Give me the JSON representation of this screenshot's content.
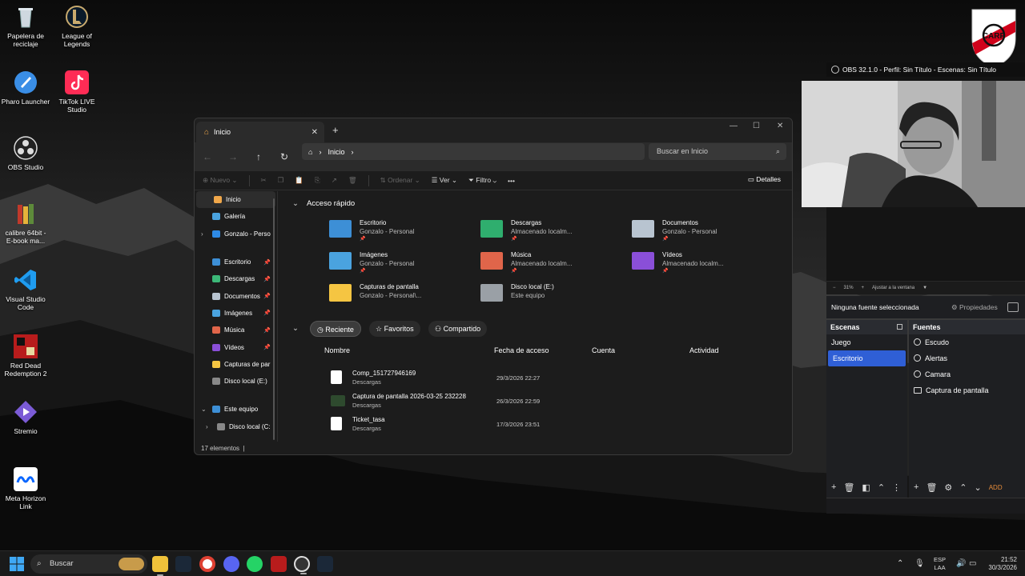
{
  "desktop": {
    "icons": [
      {
        "label_line1": "Papelera de",
        "label_line2": "reciclaje",
        "icon": "recycle-bin-icon"
      },
      {
        "label_line1": "League of",
        "label_line2": "Legends",
        "icon": "league-of-legends-icon"
      },
      {
        "label_line1": "Pharo Launcher",
        "label_line2": "",
        "icon": "pharo-launcher-icon"
      },
      {
        "label_line1": "TikTok LIVE",
        "label_line2": "Studio",
        "icon": "tiktok-live-icon"
      },
      {
        "label_line1": "OBS Studio",
        "label_line2": "",
        "icon": "obs-icon"
      },
      {
        "label_line1": "calibre 64bit -",
        "label_line2": "E-book ma...",
        "icon": "calibre-icon"
      },
      {
        "label_line1": "Visual Studio",
        "label_line2": "Code",
        "icon": "vscode-icon"
      },
      {
        "label_line1": "Red Dead",
        "label_line2": "Redemption 2",
        "icon": "rdr2-icon"
      },
      {
        "label_line1": "Stremio",
        "label_line2": "",
        "icon": "stremio-icon"
      },
      {
        "label_line1": "Meta Horizon",
        "label_line2": "Link",
        "icon": "meta-icon"
      }
    ]
  },
  "explorer": {
    "tab_title": "Inicio",
    "address": "Inicio",
    "search_placeholder": "Buscar en Inicio",
    "commands": {
      "nuevo": "Nuevo",
      "ordenar": "Ordenar",
      "ver": "Ver",
      "filtro": "Filtro",
      "more": "•••",
      "detalles": "Detalles"
    },
    "sidebar": [
      {
        "label": "Inicio",
        "color": "#f0a74a"
      },
      {
        "label": "Galería",
        "color": "#4aa3df"
      },
      {
        "label": "Gonzalo - Perso",
        "color": "#2e8ae6"
      },
      {
        "label": "Escritorio",
        "color": "#3d8fd6"
      },
      {
        "label": "Descargas",
        "color": "#3cb878"
      },
      {
        "label": "Documentos",
        "color": "#b8c4d0"
      },
      {
        "label": "Imágenes",
        "color": "#4aa3df"
      },
      {
        "label": "Música",
        "color": "#e0654a"
      },
      {
        "label": "Vídeos",
        "color": "#8a4fd8"
      },
      {
        "label": "Capturas de par",
        "color": "#f5c542"
      },
      {
        "label": "Disco local (E:)",
        "color": "#888888"
      },
      {
        "label": "Este equipo",
        "color": "#3d8fd6"
      },
      {
        "label": "Disco local (C:",
        "color": "#888888"
      }
    ],
    "quick_access_title": "Acceso rápido",
    "quick_access": [
      {
        "name": "Escritorio",
        "sub": "Gonzalo - Personal",
        "color": "#3d8fd6"
      },
      {
        "name": "Descargas",
        "sub": "Almacenado localm...",
        "color": "#2fae6e"
      },
      {
        "name": "Documentos",
        "sub": "Gonzalo - Personal",
        "color": "#b8c4d0"
      },
      {
        "name": "Imágenes",
        "sub": "Gonzalo - Personal",
        "color": "#4aa3df"
      },
      {
        "name": "Música",
        "sub": "Almacenado localm...",
        "color": "#e0654a"
      },
      {
        "name": "Vídeos",
        "sub": "Almacenado localm...",
        "color": "#8a4fd8"
      },
      {
        "name": "Capturas de pantalla",
        "sub": "Gonzalo - Personal\\...",
        "color": "#f5c542"
      },
      {
        "name": "Disco local (E:)",
        "sub": "Este equipo",
        "color": "#9aa0a6"
      }
    ],
    "pills": [
      "Reciente",
      "Favoritos",
      "Compartido"
    ],
    "columns": [
      "Nombre",
      "Fecha de acceso",
      "Cuenta",
      "Actividad"
    ],
    "files": [
      {
        "name": "Comp_151727946169",
        "location": "Descargas",
        "date": "29/3/2026 22:27",
        "icon": "chrome-pdf-icon"
      },
      {
        "name": "Captura de pantalla 2026-03-25 232228",
        "location": "Descargas",
        "date": "26/3/2026 22:59",
        "icon": "image-file-icon"
      },
      {
        "name": "Ticket_tasa",
        "location": "Descargas",
        "date": "17/3/2026 23:51",
        "icon": "chrome-pdf-icon"
      }
    ],
    "status": "17 elementos"
  },
  "obs": {
    "title": "OBS 32.1.0 - Perfil: Sin Título - Escenas: Sin Título",
    "zoom": "31%",
    "zoom_mode": "Ajustar a la ventana",
    "no_source": "Ninguna fuente seleccionada",
    "properties": "Propiedades",
    "scenes_title": "Escenas",
    "scenes": [
      "Juego",
      "Escritorio"
    ],
    "sources_title": "Fuentes",
    "sources": [
      "Escudo",
      "Alertas",
      "Camara",
      "Captura de pantalla"
    ],
    "add_label": "ADD"
  },
  "taskbar": {
    "search": "Buscar",
    "lang_line1": "ESP",
    "lang_line2": "LAA",
    "time": "21:52",
    "date": "30/3/2026"
  }
}
